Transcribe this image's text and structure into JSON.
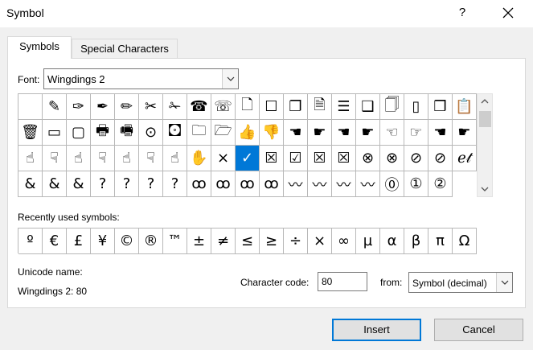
{
  "window": {
    "title": "Symbol",
    "help_label": "?"
  },
  "tabs": [
    {
      "label": "Symbols",
      "active": true
    },
    {
      "label": "Special Characters",
      "active": false
    }
  ],
  "font": {
    "label": "Font:",
    "value": "Wingdings 2"
  },
  "symbols": [
    "",
    "✎",
    "✑",
    "✒",
    "✏",
    "✂",
    "✁",
    "☎",
    "☏",
    "🗋",
    "☐",
    "❐",
    "🗎",
    "☰",
    "❑",
    "🗍",
    "▯",
    "❒",
    "📋",
    "🗑",
    "▭",
    "▢",
    "🖶",
    "🖷",
    "⊙",
    "🖸",
    "🗀",
    "🗁",
    "👍",
    "👎",
    "☚",
    "☛",
    "☚",
    "☛",
    "☜",
    "☞",
    "☚",
    "☛",
    "☝",
    "☟",
    "☝",
    "☟",
    "☝",
    "☟",
    "☝",
    "✋",
    "×",
    "✓",
    "☒",
    "☑",
    "☒",
    "☒",
    "⊗",
    "⊗",
    "⊘",
    "⊘",
    "ℯ𝓉",
    "&",
    "&",
    "&",
    "?",
    "?",
    "?",
    "?",
    "ꝏ",
    "ꝏ",
    "ꝏ",
    "ꝏ",
    "〰",
    "〰",
    "〰",
    "〰",
    "⓪",
    "①",
    "②"
  ],
  "recent": {
    "label": "Recently used symbols:",
    "items": [
      "º",
      "€",
      "£",
      "¥",
      "©",
      "®",
      "™",
      "±",
      "≠",
      "≤",
      "≥",
      "÷",
      "×",
      "∞",
      "µ",
      "α",
      "β",
      "π",
      "Ω"
    ]
  },
  "unicode": {
    "label": "Unicode name:",
    "value": "Wingdings 2: 80"
  },
  "character_code": {
    "label": "Character code:",
    "value": "80"
  },
  "from": {
    "label": "from:",
    "value": "Symbol (decimal)"
  },
  "buttons": {
    "insert": "Insert",
    "cancel": "Cancel"
  }
}
